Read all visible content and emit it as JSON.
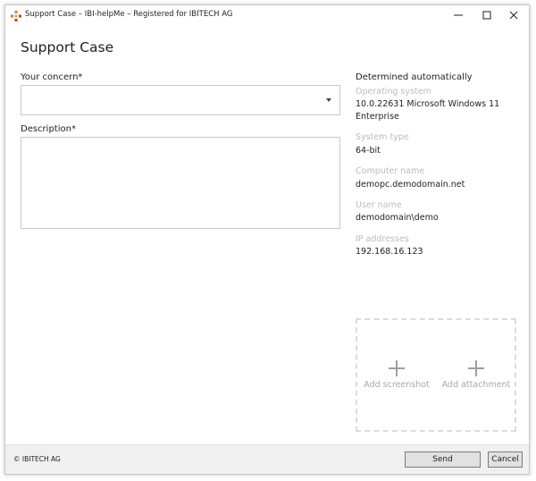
{
  "window": {
    "title": "Support Case – IBI-helpMe – Registered for IBITECH AG",
    "controls": {
      "minimize": "minimize-icon",
      "maximize": "maximize-icon",
      "close": "close-icon"
    }
  },
  "page": {
    "heading": "Support Case"
  },
  "form": {
    "concern_label": "Your concern*",
    "concern_value": "",
    "description_label": "Description*",
    "description_value": ""
  },
  "info": {
    "heading": "Determined automatically",
    "items": [
      {
        "label": "Operating system",
        "value": "10.0.22631 Microsoft Windows 11 Enterprise"
      },
      {
        "label": "System type",
        "value": "64-bit"
      },
      {
        "label": "Computer name",
        "value": "demopc.demodomain.net"
      },
      {
        "label": "User name",
        "value": "demodomain\\demo"
      },
      {
        "label": "IP addresses",
        "value": "192.168.16.123"
      }
    ]
  },
  "attachments": {
    "add_screenshot": "Add screenshot",
    "add_attachment": "Add attachment",
    "icon": "plus-icon"
  },
  "footer": {
    "copyright": "© IBITECH AG",
    "send_label": "Send",
    "cancel_label": "Cancel"
  },
  "colors": {
    "app_icon_primary": "#e8732a",
    "app_icon_secondary": "#c23b2f",
    "muted_label": "#bcbcbc",
    "footer_bg": "#f0f0f0"
  }
}
